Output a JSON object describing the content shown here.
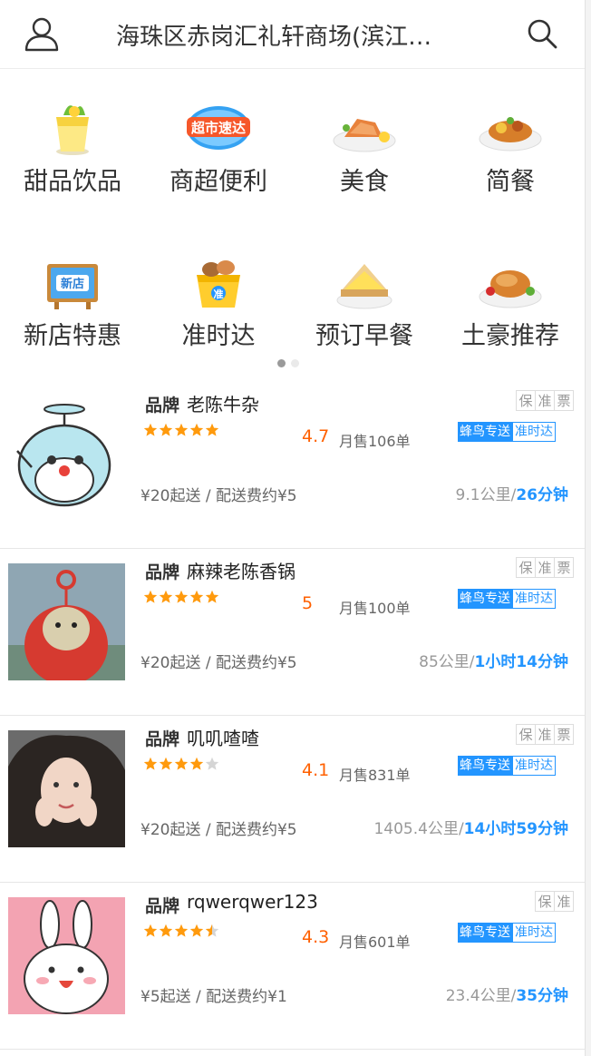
{
  "header": {
    "title": "海珠区赤岗汇礼轩商场(滨江…",
    "user_icon": "user-icon",
    "search_icon": "search-icon"
  },
  "categories": [
    {
      "label": "甜品饮品",
      "icon": "dessert-drink-icon"
    },
    {
      "label": "商超便利",
      "icon": "supermarket-express-icon",
      "icon_text": "超市速达"
    },
    {
      "label": "美食",
      "icon": "food-plate-icon"
    },
    {
      "label": "简餐",
      "icon": "simple-meal-icon"
    },
    {
      "label": "新店特惠",
      "icon": "new-store-icon",
      "icon_text": "新店"
    },
    {
      "label": "准时达",
      "icon": "on-time-icon",
      "icon_text": "准"
    },
    {
      "label": "预订早餐",
      "icon": "breakfast-sandwich-icon"
    },
    {
      "label": "土豪推荐",
      "icon": "roast-chicken-icon"
    }
  ],
  "pager": {
    "count": 2,
    "active": 0
  },
  "colors": {
    "accent_blue": "#2395ff",
    "rating_orange": "#ff6000",
    "star": "#ff9a0d",
    "brand_highlight": "#ffe14d"
  },
  "shops": [
    {
      "brand": "品牌",
      "name": "老陈牛杂",
      "guarantee": [
        "保",
        "准",
        "票"
      ],
      "stars": 5,
      "rating": "4.7",
      "sales": "月售106单",
      "delivery_fn": "蜂鸟专送",
      "delivery_ontime": "准时达",
      "min_fee": "¥20起送 / 配送费约¥5",
      "distance": "9.1公里",
      "time": "26分钟",
      "thumb": "cartoon-cat-avatar"
    },
    {
      "brand": "品牌",
      "name": "麻辣老陈香锅",
      "guarantee": [
        "保",
        "准",
        "票"
      ],
      "stars": 5,
      "rating": "5",
      "sales": "月售100单",
      "delivery_fn": "蜂鸟专送",
      "delivery_ontime": "准时达",
      "min_fee": "¥20起送 / 配送费约¥5",
      "distance": "85公里",
      "time": "1小时14分钟",
      "thumb": "teletubby-avatar"
    },
    {
      "brand": "品牌",
      "name": "叽叽喳喳",
      "guarantee": [
        "保",
        "准",
        "票"
      ],
      "stars": 4,
      "rating": "4.1",
      "sales": "月售831单",
      "delivery_fn": "蜂鸟专送",
      "delivery_ontime": "准时达",
      "min_fee": "¥20起送 / 配送费约¥5",
      "distance": "1405.4公里",
      "time": "14小时59分钟",
      "thumb": "girl-photo-avatar"
    },
    {
      "brand": "品牌",
      "name": "rqwerqwer123",
      "guarantee": [
        "保",
        "准"
      ],
      "stars": 4.5,
      "rating": "4.3",
      "sales": "月售601单",
      "delivery_fn": "蜂鸟专送",
      "delivery_ontime": "准时达",
      "min_fee": "¥5起送 / 配送费约¥1",
      "distance": "23.4公里",
      "time": "35分钟",
      "thumb": "bunny-cartoon-avatar"
    }
  ]
}
